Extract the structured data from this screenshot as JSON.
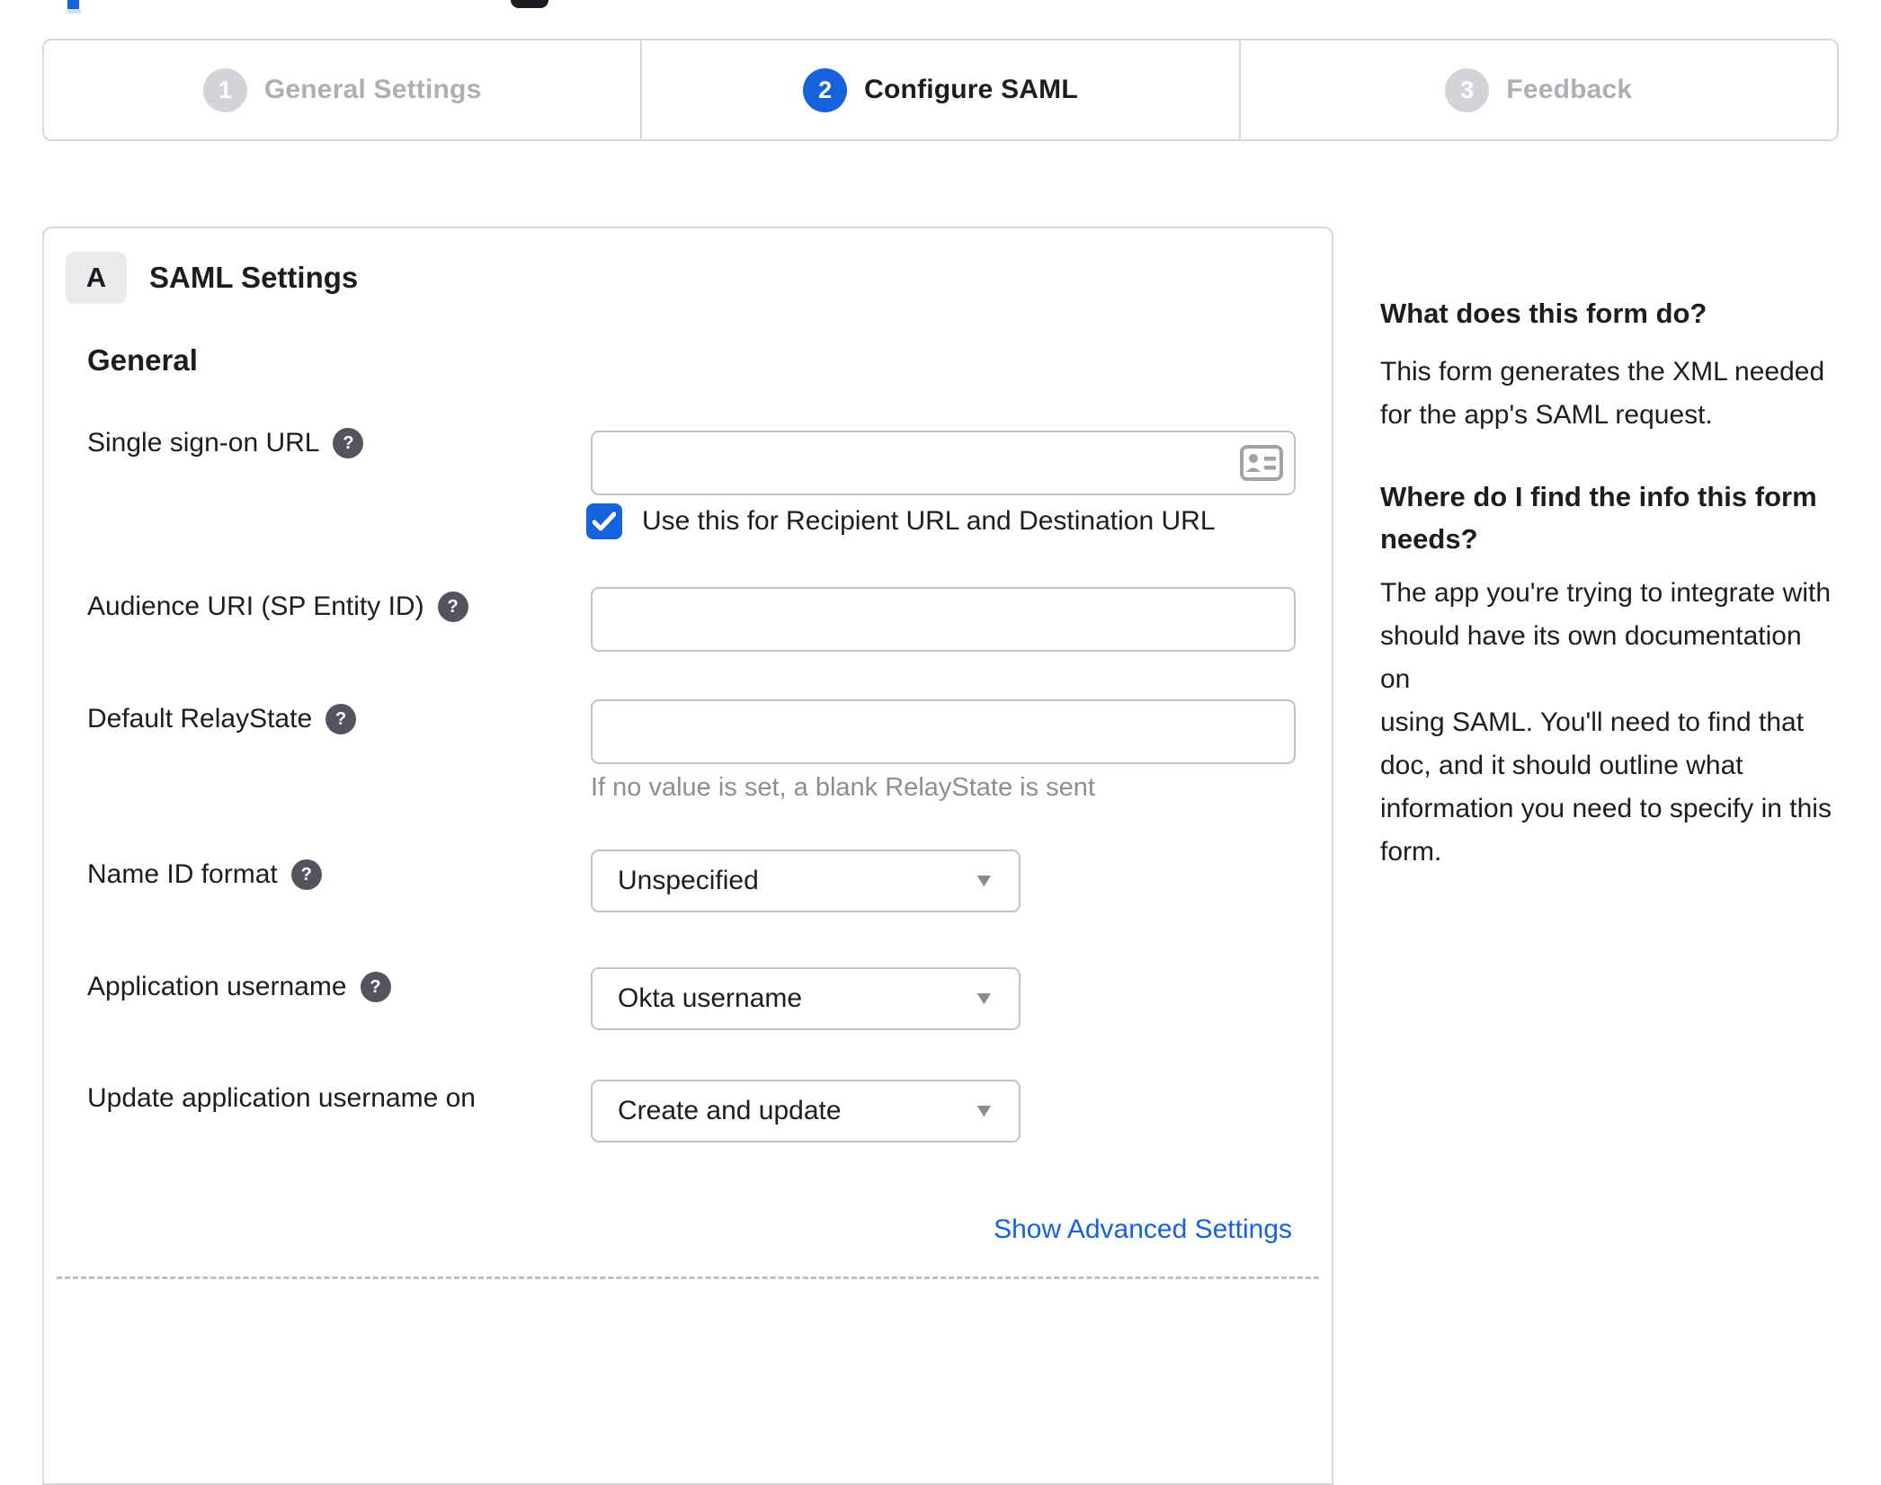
{
  "colors": {
    "accent_blue": "#1662dd",
    "border_gray": "#d8d8dc",
    "input_border": "#c3c3c8",
    "inactive_gray": "#aeaeb4",
    "hint_gray": "#8d8d93",
    "help_icon_bg": "#54545e",
    "text_dark": "#1d1d21"
  },
  "icons": {
    "help_glyph": "?",
    "caret_glyph": "▼"
  },
  "stepper": {
    "steps": [
      {
        "number": "1",
        "label": "General Settings",
        "state": "inactive"
      },
      {
        "number": "2",
        "label": "Configure SAML",
        "state": "active"
      },
      {
        "number": "3",
        "label": "Feedback",
        "state": "inactive"
      }
    ]
  },
  "panel": {
    "section_letter": "A",
    "section_title": "SAML Settings",
    "group_title": "General"
  },
  "form": {
    "sso": {
      "label": "Single sign-on URL",
      "value": "",
      "checkbox_label": "Use this for Recipient URL and Destination URL",
      "checked": true
    },
    "audience": {
      "label": "Audience URI (SP Entity ID)",
      "value": ""
    },
    "relay": {
      "label": "Default RelayState",
      "value": "",
      "hint": "If no value is set, a blank RelayState is sent"
    },
    "nameid": {
      "label": "Name ID format",
      "value": "Unspecified"
    },
    "appuser": {
      "label": "Application username",
      "value": "Okta username"
    },
    "updateuser": {
      "label": "Update application username on",
      "value": "Create and update"
    },
    "advanced_link": "Show Advanced Settings"
  },
  "sidebar": {
    "heading1": "What does this form do?",
    "paragraph1": "This form generates the XML needed\nfor the app's SAML request.",
    "heading2": "Where do I find the info this form\nneeds?",
    "paragraph2": "The app you're trying to integrate with\nshould have its own documentation on\nusing SAML. You'll need to find that\ndoc, and it should outline what\ninformation you need to specify in this\nform."
  }
}
